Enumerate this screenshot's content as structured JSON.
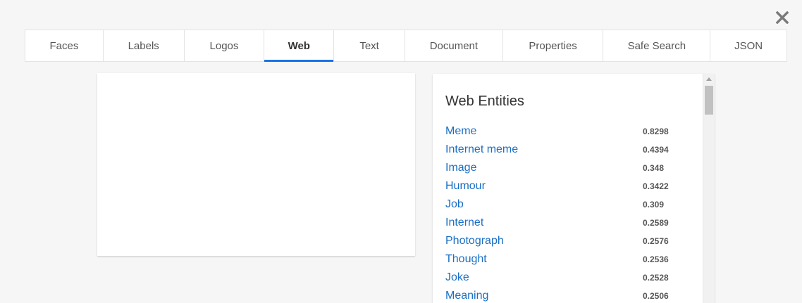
{
  "dialog": {
    "close_icon": "close-icon"
  },
  "tabs": [
    {
      "label": "Faces",
      "active": false
    },
    {
      "label": "Labels",
      "active": false
    },
    {
      "label": "Logos",
      "active": false
    },
    {
      "label": "Web",
      "active": true
    },
    {
      "label": "Text",
      "active": false
    },
    {
      "label": "Document",
      "active": false
    },
    {
      "label": "Properties",
      "active": false
    },
    {
      "label": "Safe Search",
      "active": false
    },
    {
      "label": "JSON",
      "active": false
    }
  ],
  "results": {
    "title": "Web Entities",
    "entities": [
      {
        "name": "Meme",
        "score": "0.8298"
      },
      {
        "name": "Internet meme",
        "score": "0.4394"
      },
      {
        "name": "Image",
        "score": "0.348"
      },
      {
        "name": "Humour",
        "score": "0.3422"
      },
      {
        "name": "Job",
        "score": "0.309"
      },
      {
        "name": "Internet",
        "score": "0.2589"
      },
      {
        "name": "Photograph",
        "score": "0.2576"
      },
      {
        "name": "Thought",
        "score": "0.2536"
      },
      {
        "name": "Joke",
        "score": "0.2528"
      },
      {
        "name": "Meaning",
        "score": "0.2506"
      }
    ]
  },
  "colors": {
    "accent": "#1a73e8",
    "link": "#1a6fc4",
    "background": "#f6f6f6"
  }
}
